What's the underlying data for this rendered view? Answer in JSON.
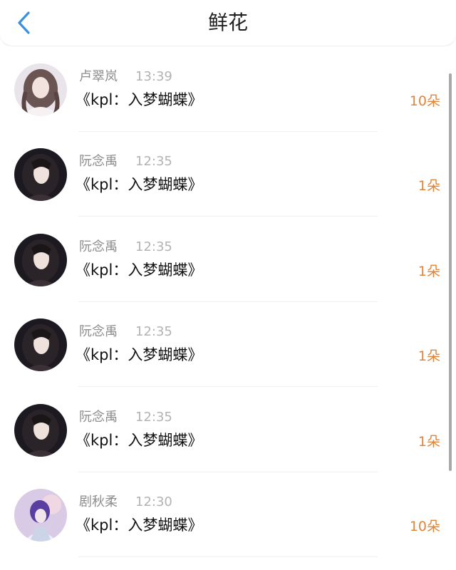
{
  "header": {
    "title": "鲜花",
    "back_icon": "chevron-left-icon"
  },
  "colors": {
    "accent_blue": "#3b8fe0",
    "count_orange": "#e0843a"
  },
  "items": [
    {
      "name": "卢翠岚",
      "time": "13:39",
      "gift": "《kpl：入梦蝴蝶》",
      "count": "10朵",
      "avatar": "light-portrait"
    },
    {
      "name": "阮念禹",
      "time": "12:35",
      "gift": "《kpl：入梦蝴蝶》",
      "count": "1朵",
      "avatar": "dark-portrait"
    },
    {
      "name": "阮念禹",
      "time": "12:35",
      "gift": "《kpl：入梦蝴蝶》",
      "count": "1朵",
      "avatar": "dark-portrait"
    },
    {
      "name": "阮念禹",
      "time": "12:35",
      "gift": "《kpl：入梦蝴蝶》",
      "count": "1朵",
      "avatar": "dark-portrait"
    },
    {
      "name": "阮念禹",
      "time": "12:35",
      "gift": "《kpl：入梦蝴蝶》",
      "count": "1朵",
      "avatar": "dark-portrait"
    },
    {
      "name": "剧秋柔",
      "time": "12:30",
      "gift": "《kpl：入梦蝴蝶》",
      "count": "10朵",
      "avatar": "purple-portrait"
    }
  ]
}
